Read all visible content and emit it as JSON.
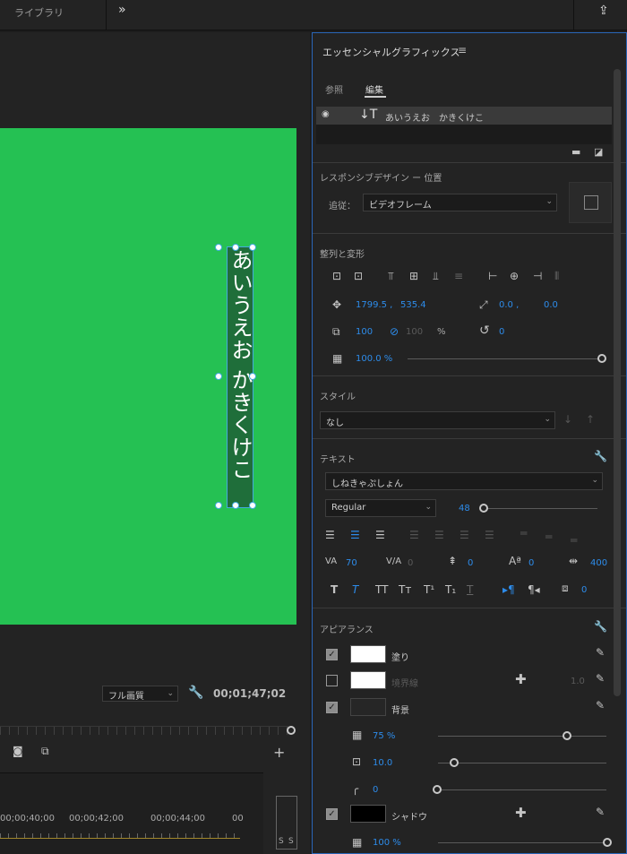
{
  "topbar": {
    "tab_library": "ライブラリ",
    "more": "»",
    "share": "⇪"
  },
  "viewer": {
    "title_text": "あいうえお かきくけこ",
    "quality": "フル画質",
    "timecode": "00;01;47;02",
    "timeline_labels": [
      "00;00;40;00",
      "00;00;42;00",
      "00;00;44;00",
      "00"
    ],
    "track_s1": "S",
    "track_s2": "S"
  },
  "panel": {
    "title": "エッセンシャルグラフィックス",
    "menu": "≡",
    "tabs": {
      "browse": "参照",
      "edit": "編集"
    },
    "layer_name": "あいうえお　かきくけこ",
    "responsive_title": "レスポンシブデザイン ー 位置",
    "follow_label": "追従：",
    "follow_value": "ビデオフレーム",
    "align_title": "整列と変形",
    "position_x": "1799.5 ,",
    "position_y": "535.4",
    "anchor_x": "0.0 ,",
    "anchor_y": "0.0",
    "scale": "100",
    "scale_lock_value": "100",
    "scale_unit": "%",
    "rotation": "0",
    "opacity": "100.0 %",
    "style_title": "スタイル",
    "style_value": "なし",
    "text_title": "テキスト",
    "font_family": "しねきゃぷしょん",
    "font_style": "Regular",
    "font_size": "48",
    "tracking": "70",
    "kerning": "0",
    "leading": "0",
    "baseline": "0",
    "tsume": "400",
    "tab_width": "0",
    "appearance_title": "アピアランス",
    "fill_label": "塗り",
    "stroke_label": "境界線",
    "stroke_value": "1.0",
    "background_label": "背景",
    "bg_opacity": "75 %",
    "bg_size": "10.0",
    "bg_corner": "0",
    "shadow_label": "シャドウ",
    "shadow_opacity": "100 %"
  },
  "colors": {
    "screen_green": "#25c153",
    "accent_blue": "#2d8ceb"
  }
}
